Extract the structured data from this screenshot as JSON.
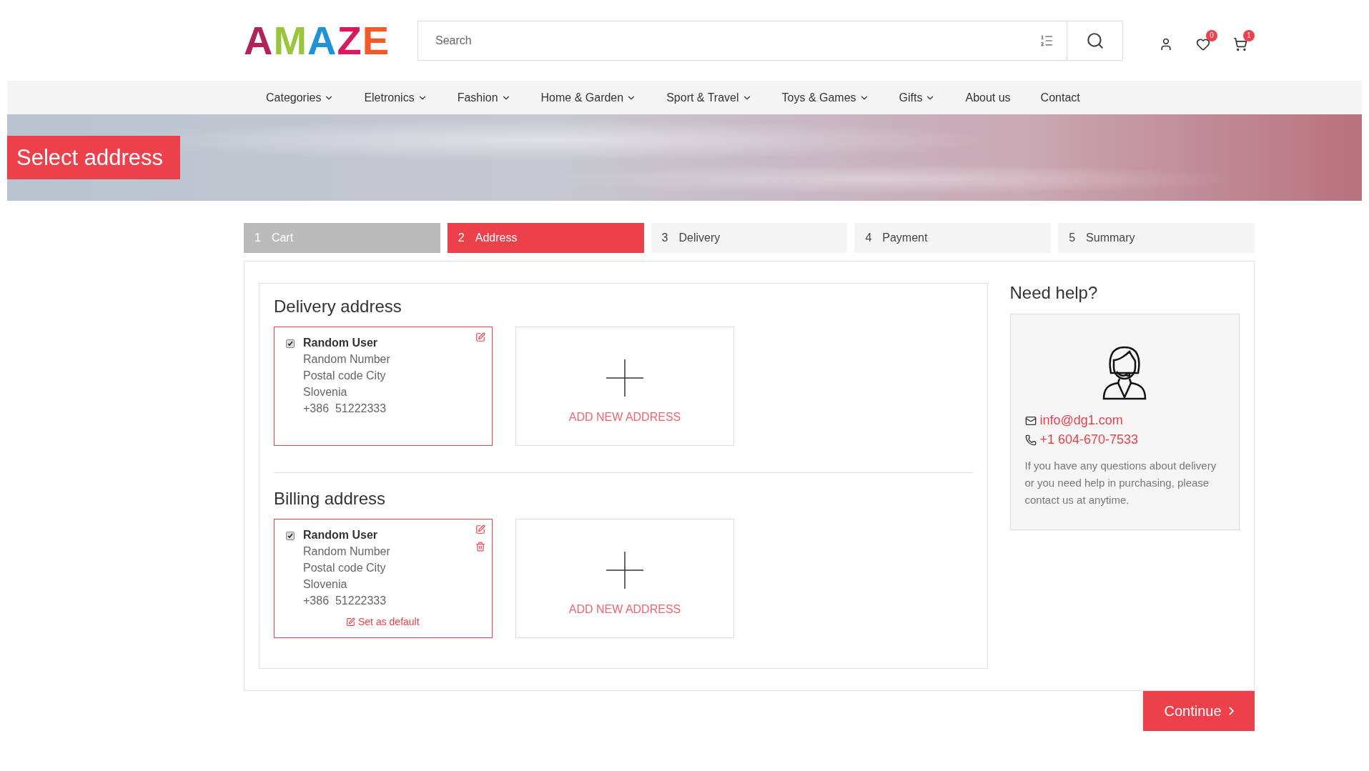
{
  "header": {
    "logo": [
      {
        "char": "A",
        "color": "#b0245e"
      },
      {
        "char": "M",
        "color": "#9bc53d"
      },
      {
        "char": "A",
        "color": "#1f93d6"
      },
      {
        "char": "Z",
        "color": "#d8195f"
      },
      {
        "char": "E",
        "color": "#f15a29"
      }
    ],
    "search": {
      "placeholder": "Search"
    },
    "wishlist_count": "0",
    "cart_count": "1"
  },
  "nav": [
    {
      "label": "Categories",
      "dropdown": true
    },
    {
      "label": "Eletronics",
      "dropdown": true
    },
    {
      "label": "Fashion",
      "dropdown": true
    },
    {
      "label": "Home & Garden",
      "dropdown": true
    },
    {
      "label": "Sport & Travel",
      "dropdown": true
    },
    {
      "label": "Toys & Games",
      "dropdown": true
    },
    {
      "label": "Gifts",
      "dropdown": true
    },
    {
      "label": "About us",
      "dropdown": false
    },
    {
      "label": "Contact",
      "dropdown": false
    }
  ],
  "banner": {
    "title": "Select address"
  },
  "steps": [
    {
      "number": "1",
      "label": "Cart",
      "selected": false,
      "completed": true
    },
    {
      "number": "2",
      "label": "Address",
      "selected": true,
      "completed": false
    },
    {
      "number": "3",
      "label": "Delivery",
      "selected": false,
      "completed": false
    },
    {
      "number": "4",
      "label": "Payment",
      "selected": false,
      "completed": false
    },
    {
      "number": "5",
      "label": "Summary",
      "selected": false,
      "completed": false
    }
  ],
  "sections": [
    {
      "heading": "Delivery address",
      "cards": [
        {
          "name": "Random User",
          "lines": [
            "Random Number",
            "Postal code City",
            "Slovenia",
            "+386  51222333"
          ],
          "checked": true,
          "deletable": false
        }
      ],
      "add_label": "ADD NEW ADDRESS"
    },
    {
      "heading": "Billing address",
      "cards": [
        {
          "name": "Random User",
          "lines": [
            "Random Number",
            "Postal code City",
            "Slovenia",
            "+386  51222333"
          ],
          "checked": true,
          "deletable": true,
          "set_default": "Set as default"
        }
      ],
      "add_label": "ADD NEW ADDRESS"
    }
  ],
  "help": {
    "title": "Need help?",
    "email": "info@dg1.com",
    "phone": "+1 604-670-7533",
    "text": "If you have any questions about delivery or you need help in purchasing, please contact us at anytime."
  },
  "continue_button": "Continue"
}
